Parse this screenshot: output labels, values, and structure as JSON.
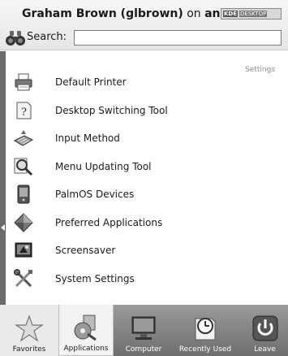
{
  "header": {
    "user_name": "Graham Brown (glbrown)",
    "on_text": " on ",
    "host": "anderso",
    "badge_kde": "KDE",
    "badge_desktop": "DESKTOP"
  },
  "search": {
    "label": "Search:",
    "value": "",
    "placeholder": ""
  },
  "main": {
    "section_title": "Settings",
    "items": [
      {
        "label": "Default Printer",
        "icon": "printer-icon"
      },
      {
        "label": "Desktop Switching Tool",
        "icon": "help-icon"
      },
      {
        "label": "Input Method",
        "icon": "keyboard-icon"
      },
      {
        "label": "Menu Updating Tool",
        "icon": "magnifier-icon"
      },
      {
        "label": "PalmOS Devices",
        "icon": "pda-icon"
      },
      {
        "label": "Preferred Applications",
        "icon": "diamond-icon"
      },
      {
        "label": "Screensaver",
        "icon": "screensaver-icon"
      },
      {
        "label": "System Settings",
        "icon": "tools-icon"
      }
    ]
  },
  "tabs": [
    {
      "label": "Favorites",
      "icon": "star-icon",
      "active": false
    },
    {
      "label": "Applications",
      "icon": "applications-icon",
      "active": true
    },
    {
      "label": "Computer",
      "icon": "computer-icon",
      "active": false
    },
    {
      "label": "Recently Used",
      "icon": "clock-icon",
      "active": false
    },
    {
      "label": "Leave",
      "icon": "power-icon",
      "active": false
    }
  ],
  "colors": {
    "tab_bar": "#7a7a7a",
    "side_strip": "#6b6b6b",
    "section_title": "#8a8a8a"
  }
}
